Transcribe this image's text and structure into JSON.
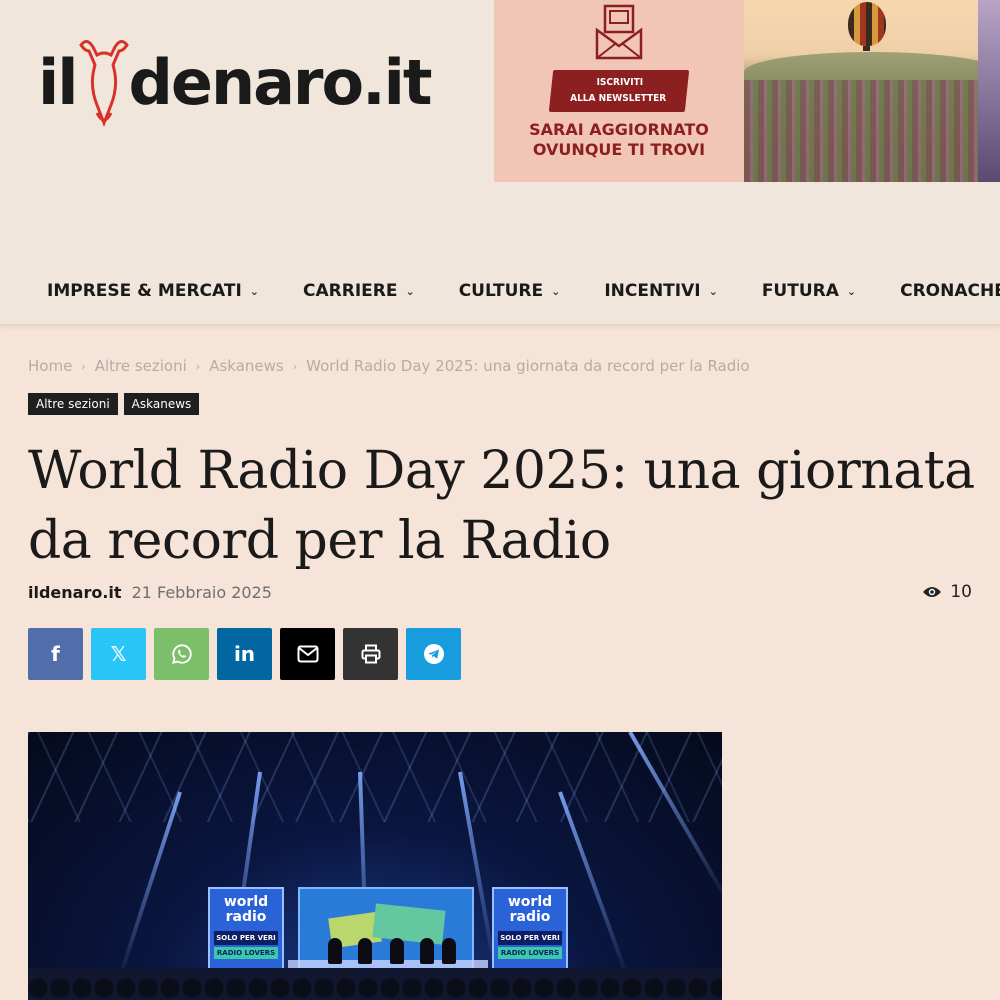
{
  "logo": {
    "il": "il",
    "rest": "denaro.it"
  },
  "banner": {
    "pill_line1": "ISCRIVITI",
    "pill_line2": "ALLA NEWSLETTER",
    "text_line1": "SARAI AGGIORNATO",
    "text_line2": "OVUNQUE TI TROVI"
  },
  "nav": {
    "items": [
      {
        "label": "IMPRESE & MERCATI"
      },
      {
        "label": "CARRIERE"
      },
      {
        "label": "CULTURE"
      },
      {
        "label": "INCENTIVI"
      },
      {
        "label": "FUTURA"
      },
      {
        "label": "CRONACHE"
      }
    ]
  },
  "breadcrumb": {
    "items": [
      "Home",
      "Altre sezioni",
      "Askanews",
      "World Radio Day 2025: una giornata da record per la Radio"
    ]
  },
  "tags": [
    "Altre sezioni",
    "Askanews"
  ],
  "article": {
    "title": "World Radio Day 2025: una giornata da record per la Radio",
    "author": "ildenaro.it",
    "date": "21 Febbraio 2025",
    "views": "10"
  },
  "share": {
    "facebook": "f",
    "twitter": "𝕏",
    "linkedin": "in"
  },
  "photo": {
    "screen_title_line1": "world",
    "screen_title_line2": "radio",
    "screen_sub1": "SOLO PER VERI",
    "screen_sub2": "RADIO LOVERS"
  },
  "colors": {
    "page_bg": "#f7e4d8",
    "header_bg": "#f1e6dc",
    "banner_accent": "#8c1f1f",
    "facebook": "#516eab",
    "twitter": "#29c5f6",
    "whatsapp": "#7bbf6a",
    "linkedin": "#0266a0",
    "email": "#000000",
    "print": "#333333",
    "telegram": "#179cde"
  }
}
